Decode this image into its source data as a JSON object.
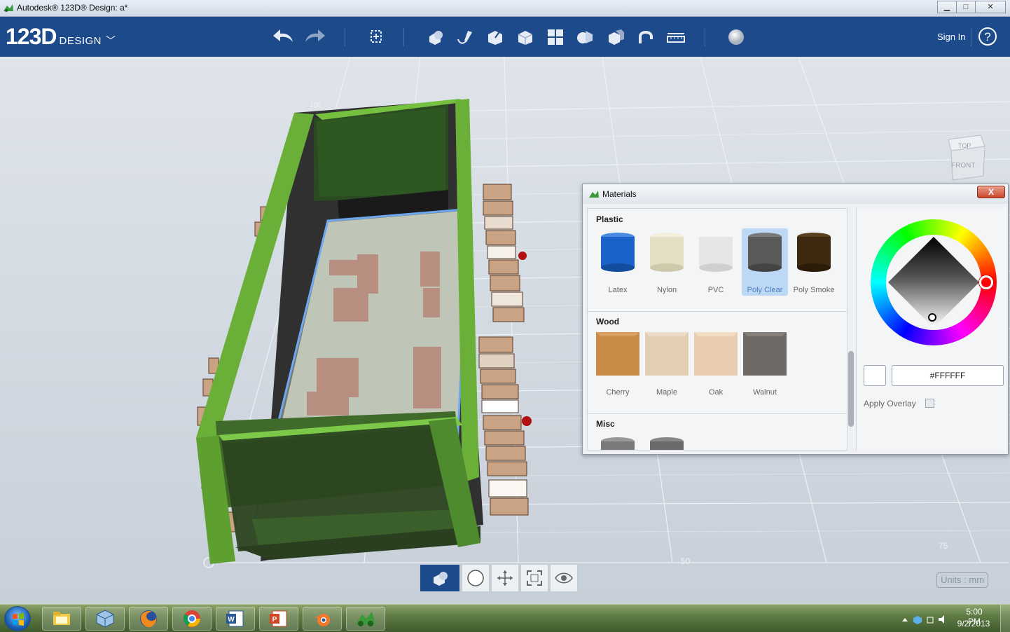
{
  "window": {
    "title": "Autodesk® 123D® Design: a*",
    "buttons": [
      "minimize-icon",
      "maximize-icon",
      "close-icon"
    ]
  },
  "toolbar": {
    "logo_main": "123D",
    "logo_sub": "DESIGN",
    "sign_in": "Sign In",
    "help": "?",
    "tools": [
      "undo-icon",
      "redo-icon",
      "transform-icon",
      "primitives-icon",
      "sketch-icon",
      "construct-icon",
      "modify-icon",
      "pattern-icon",
      "grouping-icon",
      "combine-icon",
      "snap-icon",
      "measure-icon",
      "material-icon"
    ]
  },
  "viewport": {
    "grid_labels": {
      "a": "100",
      "b": "50",
      "c": "75"
    },
    "viewcube": {
      "top": "TOP",
      "front": "FRONT"
    },
    "units": "Units : mm",
    "viewbar": [
      "solid-view-icon",
      "material-view-icon",
      "pan-orbit-icon",
      "fit-view-icon",
      "visibility-icon"
    ]
  },
  "materials": {
    "title": "Materials",
    "close": "X",
    "sections": [
      {
        "name": "Plastic",
        "items": [
          {
            "label": "Latex",
            "color": "#1a63c8"
          },
          {
            "label": "Nylon",
            "color": "#e4dfc4"
          },
          {
            "label": "PVC",
            "color": "#e6e6e6"
          },
          {
            "label": "Poly Clear",
            "color": "#5a5a5a",
            "selected": true
          },
          {
            "label": "Poly Smoke",
            "color": "#3d2a10"
          }
        ]
      },
      {
        "name": "Wood",
        "items": [
          {
            "label": "Cherry",
            "color": "#c98b47"
          },
          {
            "label": "Maple",
            "color": "#e2cdb5"
          },
          {
            "label": "Oak",
            "color": "#e8cdb0"
          },
          {
            "label": "Walnut",
            "color": "#6f6a66"
          }
        ]
      },
      {
        "name": "Misc",
        "items": [
          {
            "label": "",
            "color": "#7a7a7a"
          },
          {
            "label": "",
            "color": "#6a6a6a"
          }
        ]
      }
    ],
    "color_hex": "#FFFFFF",
    "apply_overlay": "Apply Overlay"
  },
  "taskbar": {
    "apps": [
      "windows-explorer-icon",
      "virtualbox-icon",
      "firefox-icon",
      "chrome-icon",
      "word-icon",
      "powerpoint-icon",
      "blender-icon",
      "123d-design-icon"
    ],
    "time": "5:00 PM",
    "date": "9/2/2013"
  }
}
